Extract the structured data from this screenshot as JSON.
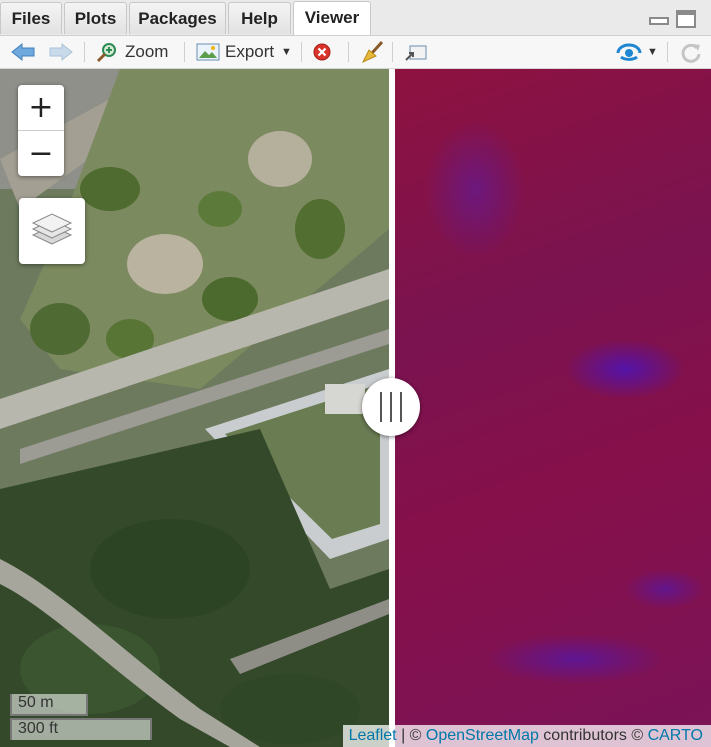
{
  "tabs": [
    "Files",
    "Plots",
    "Packages",
    "Help",
    "Viewer"
  ],
  "active_tab": "Viewer",
  "toolbar": {
    "zoom_label": "Zoom",
    "export_label": "Export"
  },
  "map": {
    "zoom_in_label": "+",
    "zoom_out_label": "−",
    "scale_metric": "50 m",
    "scale_imperial": "300 ft",
    "attribution": {
      "leaflet": "Leaflet",
      "sep": " | © ",
      "osm": "OpenStreetMap",
      "middle": " contributors © ",
      "carto": "CARTO"
    }
  },
  "colors": {
    "raster_red": "#8e1240",
    "raster_blue": "#4a18c8",
    "link": "#0078a8"
  }
}
